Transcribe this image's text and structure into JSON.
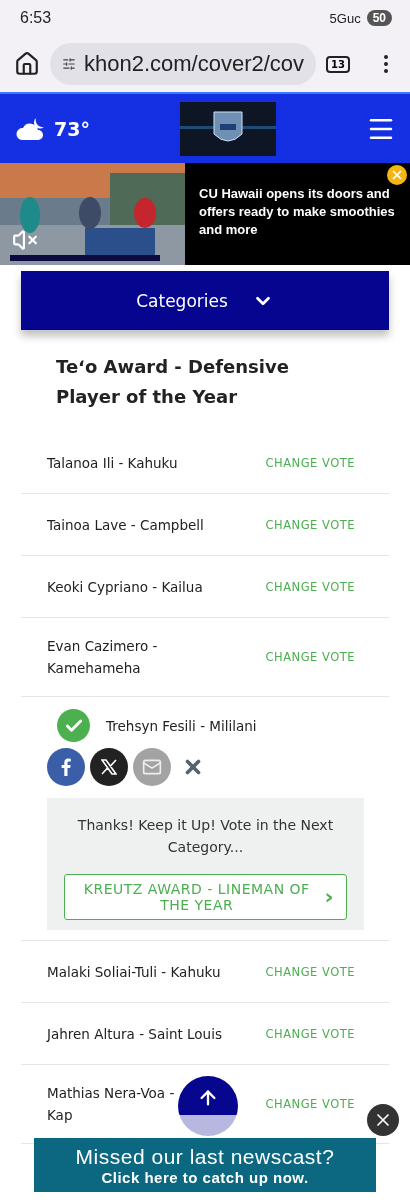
{
  "status_bar": {
    "time": "6:53",
    "network": "5Guc",
    "battery": "50"
  },
  "browser": {
    "url": "khon2.com/cover2/cov",
    "tab_count": "13"
  },
  "header": {
    "temperature": "73°"
  },
  "video_ad": {
    "headline": "CU Hawaii opens its doors and offers ready to make smoothies and more",
    "muted": true
  },
  "categories": {
    "label": "Categories"
  },
  "category_title": "Teʻo Award - Defensive Player of the Year",
  "nominees": [
    {
      "name": "Talanoa Ili - Kahuku",
      "voted": false,
      "action": "CHANGE VOTE"
    },
    {
      "name": "Tainoa Lave - Campbell",
      "voted": false,
      "action": "CHANGE VOTE"
    },
    {
      "name": "Keoki Cypriano - Kailua",
      "voted": false,
      "action": "CHANGE VOTE"
    },
    {
      "name": "Evan Cazimero - Kamehameha",
      "voted": false,
      "action": "CHANGE VOTE"
    },
    {
      "name": "Trehsyn Fesili - Mililani",
      "voted": true
    },
    {
      "name": "Malaki Soliai-Tuli - Kahuku",
      "voted": false,
      "action": "CHANGE VOTE"
    },
    {
      "name": "Jahren Altura - Saint Louis",
      "voted": false,
      "action": "CHANGE VOTE"
    },
    {
      "name": "Mathias Nera-Voa - Kap",
      "voted": false,
      "action": "CHANGE VOTE"
    }
  ],
  "thanks": {
    "message": "Thanks! Keep it Up! Vote in the Next Category...",
    "next_button": "KREUTZ AWARD - LINEMAN OF THE YEAR",
    "next_arrow": "›"
  },
  "banner": {
    "line_1": "Missed our last newscast?",
    "line_2": "Click here to catch up now."
  }
}
